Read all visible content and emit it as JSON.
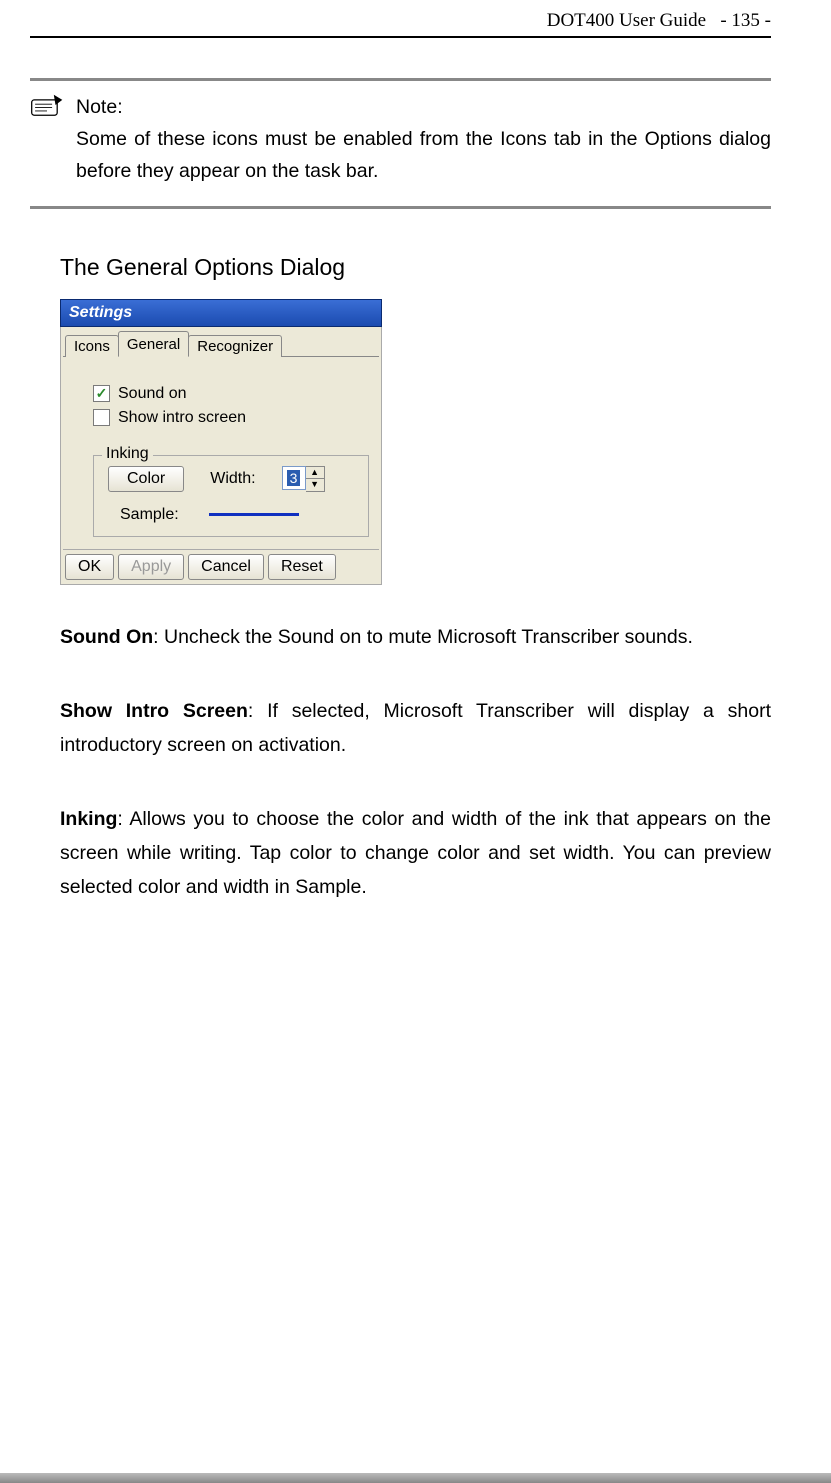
{
  "header": {
    "guide_title": "DOT400 User Guide",
    "page_label": "- 135 -"
  },
  "note": {
    "label": "Note:",
    "body": "Some of these icons must be enabled from the Icons tab in the Options dialog before they appear on the task bar."
  },
  "section_heading": "The General Options Dialog",
  "dialog": {
    "title": "Settings",
    "tabs": {
      "icons": "Icons",
      "general": "General",
      "recognizer": "Recognizer"
    },
    "checkboxes": {
      "sound_on": "Sound on",
      "show_intro": "Show intro screen"
    },
    "inking": {
      "legend": "Inking",
      "color_btn": "Color",
      "width_label": "Width:",
      "width_value": "3",
      "sample_label": "Sample:"
    },
    "buttons": {
      "ok": "OK",
      "apply": "Apply",
      "cancel": "Cancel",
      "reset": "Reset"
    }
  },
  "descriptions": {
    "sound_on": {
      "term": "Sound On",
      "body": ": Uncheck the Sound on to mute Microsoft Transcriber sounds."
    },
    "show_intro": {
      "term": "Show Intro Screen",
      "body": ": If selected, Microsoft Transcriber will display a short introductory screen on activation."
    },
    "inking": {
      "term": "Inking",
      "body": ": Allows you to choose the color and width of the ink that appears on the screen while writing. Tap color to change color and set width. You can preview selected color and width in Sample."
    }
  }
}
